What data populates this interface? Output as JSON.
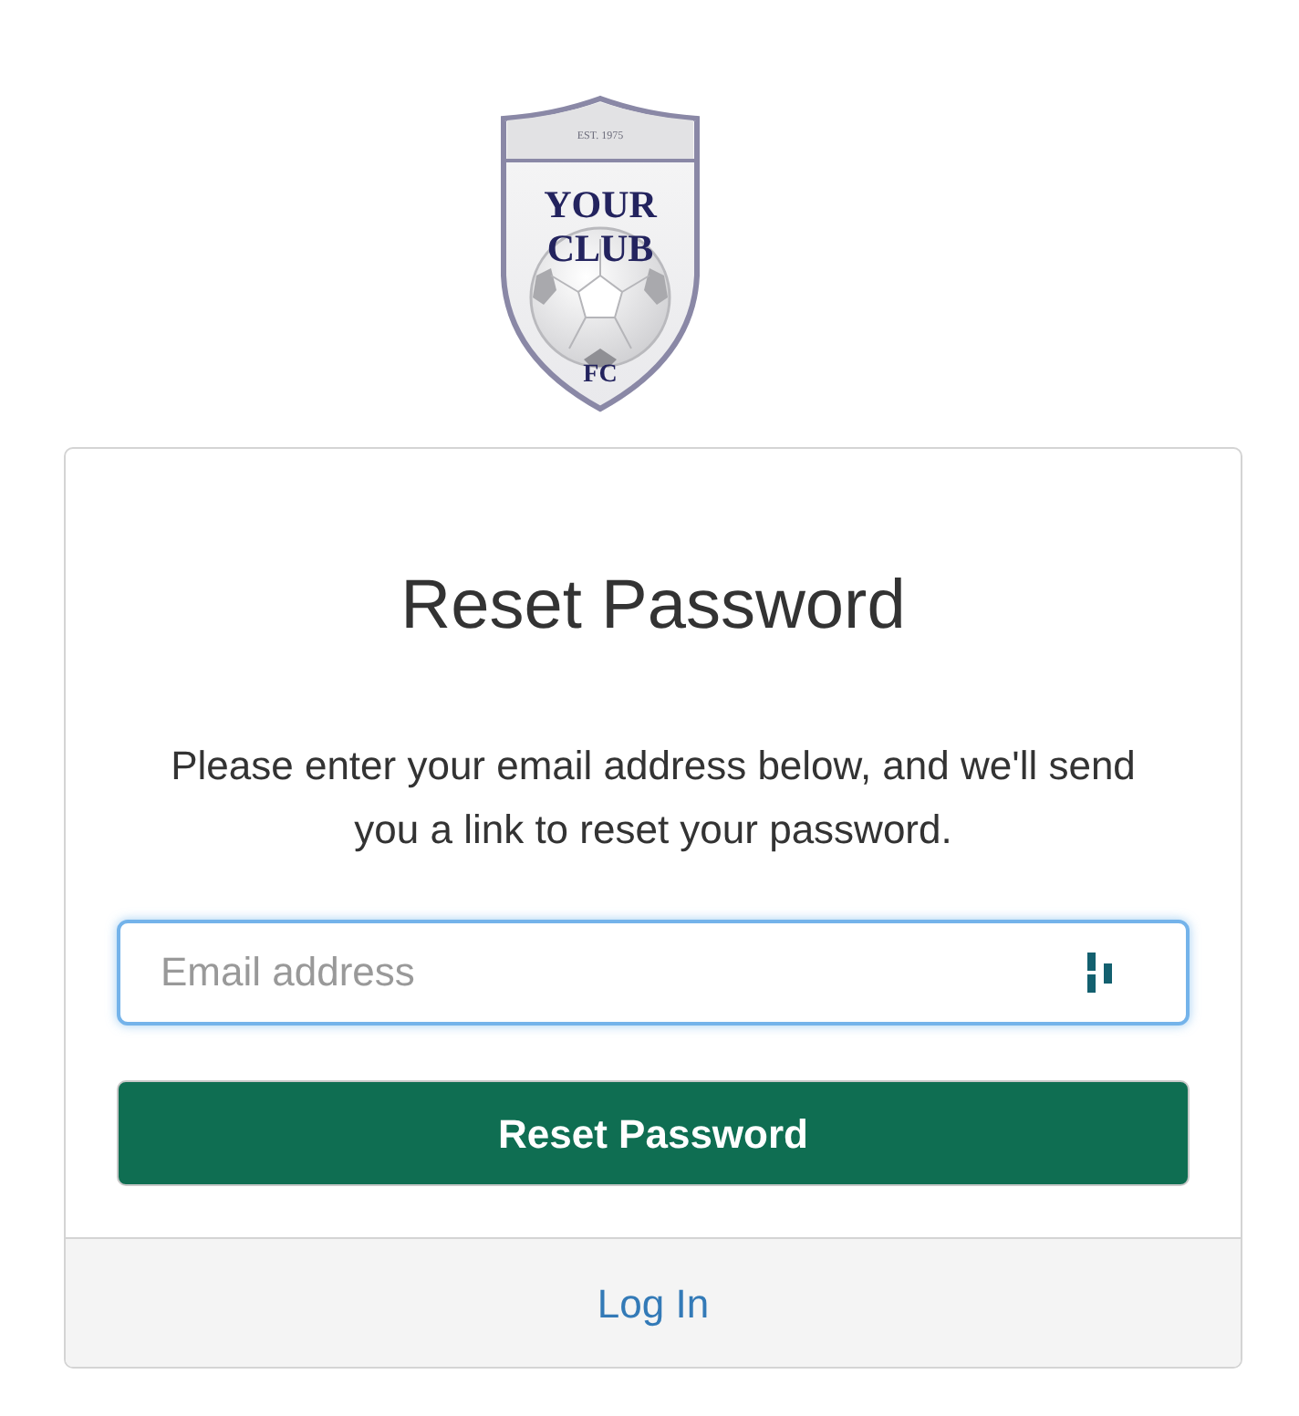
{
  "logo": {
    "established": "EST. 1975",
    "name_lines": [
      "YOUR",
      "CLUB"
    ],
    "suffix": "FC"
  },
  "card": {
    "title": "Reset Password",
    "instructions": "Please enter your email address below, and we'll send you a link to reset your password.",
    "email_field": {
      "placeholder": "Email address",
      "focused": true
    },
    "submit_button": "Reset Password",
    "footer_link": "Log In"
  }
}
